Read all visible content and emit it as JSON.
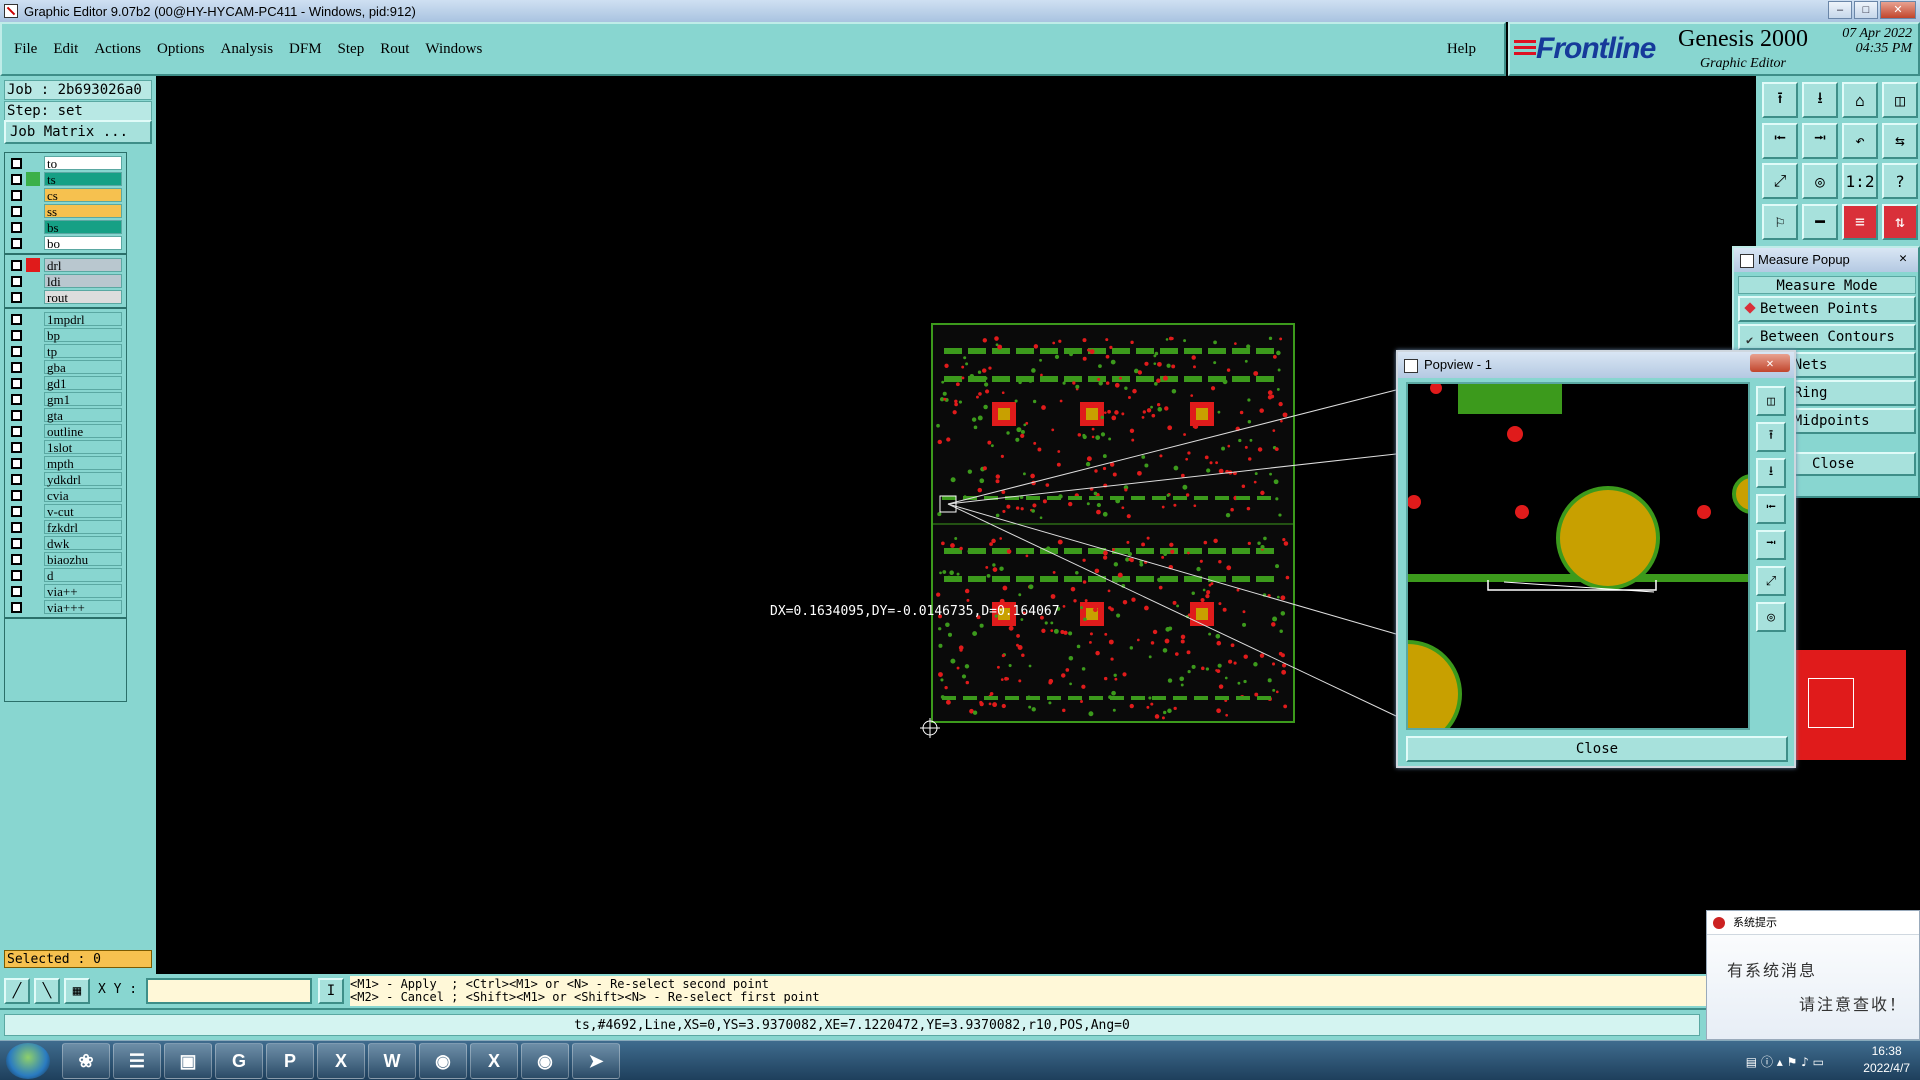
{
  "window": {
    "title": "Graphic Editor 9.07b2 (00@HY-HYCAM-PC411 - Windows, pid:912)"
  },
  "menu": {
    "items": [
      "File",
      "Edit",
      "Actions",
      "Options",
      "Analysis",
      "DFM",
      "Step",
      "Rout",
      "Windows"
    ],
    "help": "Help"
  },
  "brand": {
    "logo": "Frontline",
    "product": "Genesis 2000",
    "subtitle": "Graphic Editor",
    "date": "07 Apr 2022",
    "time": "04:35 PM"
  },
  "job": {
    "job": "Job : 2b693026a0",
    "step": "Step: set",
    "matrix_button": "Job Matrix ..."
  },
  "layers": {
    "groups": [
      [
        {
          "name": "to",
          "color": "#ffffff",
          "swatch": ""
        },
        {
          "name": "ts",
          "color": "#16a085",
          "swatch": "#3cb04a",
          "active": true
        },
        {
          "name": "cs",
          "color": "#f6c14f",
          "swatch": ""
        },
        {
          "name": "ss",
          "color": "#f6c14f",
          "swatch": ""
        },
        {
          "name": "bs",
          "color": "#16a085",
          "swatch": ""
        },
        {
          "name": "bo",
          "color": "#ffffff",
          "swatch": ""
        }
      ],
      [
        {
          "name": "drl",
          "color": "#b9c7cf",
          "swatch": "#e01b1b"
        },
        {
          "name": "ldi",
          "color": "#b9c7cf",
          "swatch": ""
        },
        {
          "name": "rout",
          "color": "#dddddd",
          "swatch": ""
        }
      ],
      [
        {
          "name": "1mpdrl",
          "color": "#88d6d0",
          "swatch": ""
        },
        {
          "name": "bp",
          "color": "#88d6d0",
          "swatch": ""
        },
        {
          "name": "tp",
          "color": "#88d6d0",
          "swatch": ""
        },
        {
          "name": "gba",
          "color": "#88d6d0",
          "swatch": ""
        },
        {
          "name": "gd1",
          "color": "#88d6d0",
          "swatch": ""
        },
        {
          "name": "gm1",
          "color": "#88d6d0",
          "swatch": ""
        },
        {
          "name": "gta",
          "color": "#88d6d0",
          "swatch": ""
        },
        {
          "name": "outline",
          "color": "#88d6d0",
          "swatch": ""
        },
        {
          "name": "1slot",
          "color": "#88d6d0",
          "swatch": ""
        },
        {
          "name": "mpth",
          "color": "#88d6d0",
          "swatch": ""
        },
        {
          "name": "ydkdrl",
          "color": "#88d6d0",
          "swatch": ""
        },
        {
          "name": "cvia",
          "color": "#88d6d0",
          "swatch": ""
        },
        {
          "name": "v-cut",
          "color": "#88d6d0",
          "swatch": ""
        },
        {
          "name": "fzkdrl",
          "color": "#88d6d0",
          "swatch": ""
        },
        {
          "name": "dwk",
          "color": "#88d6d0",
          "swatch": ""
        },
        {
          "name": "biaozhu",
          "color": "#88d6d0",
          "swatch": ""
        },
        {
          "name": "d",
          "color": "#88d6d0",
          "swatch": ""
        },
        {
          "name": "via++",
          "color": "#88d6d0",
          "swatch": ""
        },
        {
          "name": "via+++",
          "color": "#88d6d0",
          "swatch": ""
        }
      ]
    ]
  },
  "selected": "Selected : 0",
  "canvas": {
    "measurement": "DX=0.1634095,DY=-0.0146735,D=0.164067"
  },
  "measure_popup": {
    "title": "Measure Popup",
    "mode": "Measure Mode",
    "options": [
      "Between Points",
      "Between Contours",
      "een Nets",
      "lar Ring",
      "een Midpoints"
    ],
    "close": "Close"
  },
  "popview": {
    "title": "Popview - 1",
    "close": "Close"
  },
  "bottom": {
    "xy_label": "X Y :",
    "xy_value": "",
    "prompt_line1": "<M1> - Apply  ; <Ctrl><M1> or <N> - Re-select second point",
    "prompt_line2": "<M2> - Cancel ; <Shift><M1> or <Shift><N> - Re-select first point",
    "status": "ts,#4692,Line,XS=0,YS=3.9370082,XE=7.1220472,YE=3.9370082,r10,POS,Ang=0"
  },
  "notification": {
    "title": "系统提示",
    "line1": "有系统消息",
    "line2": "请注意查收！"
  },
  "taskbar": {
    "apps": [
      "❀",
      "☰",
      "▣",
      "G",
      "P",
      "X",
      "W",
      "◉",
      "X",
      "◉",
      "➤"
    ],
    "time": "16:38",
    "date": "2022/4/7"
  },
  "colors": {
    "panel": "#88d6d0",
    "board_green": "#3c9a1c",
    "pad_red": "#e01b1b",
    "pad_gold": "#c8a000"
  }
}
